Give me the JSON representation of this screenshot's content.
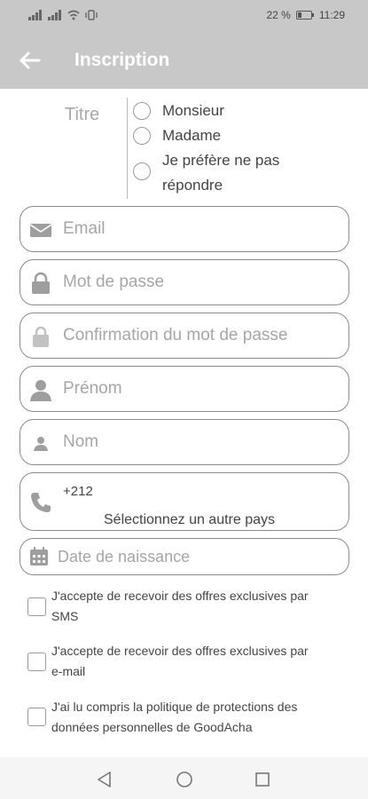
{
  "status": {
    "battery": "22 %",
    "time": "11:29"
  },
  "appbar": {
    "title": "Inscription"
  },
  "titre": {
    "label": "Titre",
    "options": [
      {
        "label": "Monsieur"
      },
      {
        "label": "Madame"
      },
      {
        "label_line1": "Je préfère ne pas",
        "label_line2": "répondre"
      }
    ]
  },
  "fields": {
    "email": {
      "placeholder": "Email",
      "icon": "mail-icon"
    },
    "password": {
      "placeholder": "Mot de passe",
      "icon": "lock-icon"
    },
    "password_confirm": {
      "placeholder": "Confirmation du mot de passe",
      "icon": "lock-icon"
    },
    "firstname": {
      "placeholder": "Prénom",
      "icon": "person-icon"
    },
    "lastname": {
      "placeholder": "Nom",
      "icon": "person-icon"
    },
    "phone": {
      "code": "+212",
      "country_link": "Sélectionnez un autre pays",
      "icon": "phone-icon"
    },
    "birthdate": {
      "placeholder": "Date de naissance",
      "icon": "calendar-icon"
    }
  },
  "consents": [
    {
      "line1": "J'accepte de recevoir des offres exclusives par",
      "line2": "SMS"
    },
    {
      "line1": "J'accepte de recevoir des offres exclusives par",
      "line2": "e-mail"
    },
    {
      "line1": "J'ai lu compris la politique de protections des",
      "line2": "données personnelles de  GoodAcha"
    }
  ],
  "colors": {
    "header": "#c8c8c8",
    "border": "#8a8a8a",
    "placeholder": "#a6a6a6"
  }
}
